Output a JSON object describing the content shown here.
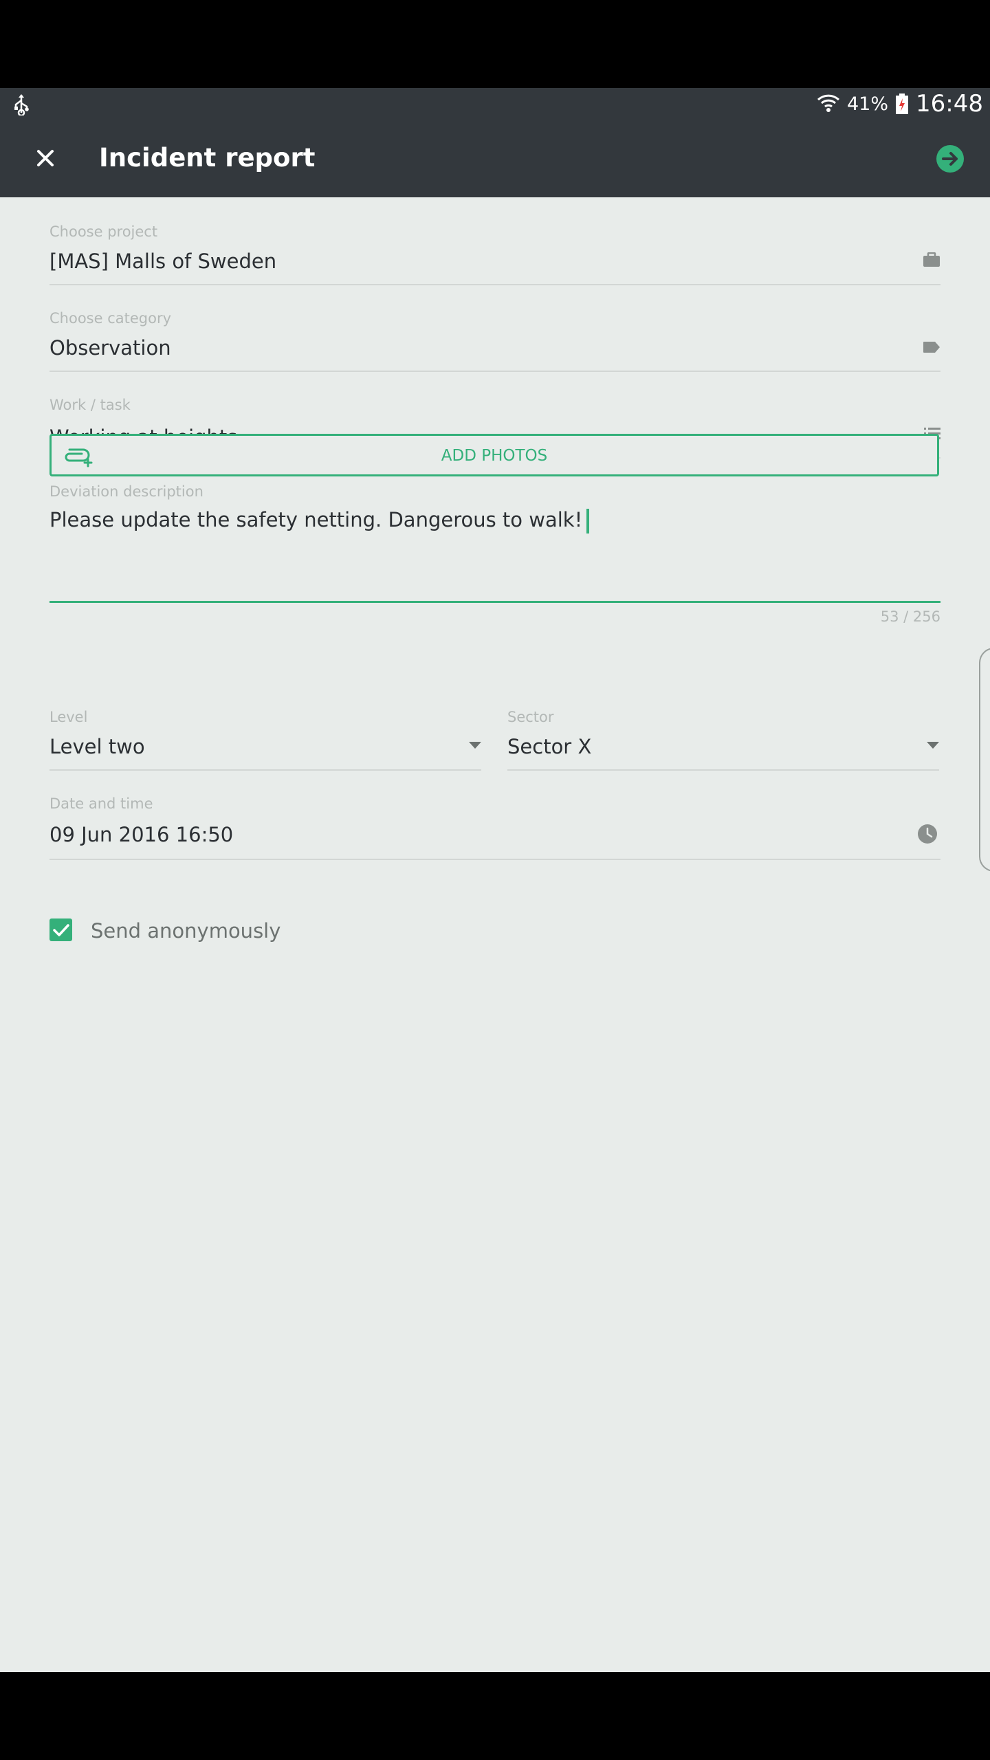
{
  "status_bar": {
    "battery_percent": "41%",
    "time": "16:48",
    "usb_icon": "usb-icon",
    "wifi_icon": "wifi-icon",
    "battery_icon": "battery-icon"
  },
  "app_bar": {
    "title": "Incident report",
    "close_icon": "close-icon",
    "submit_icon": "arrow-right-circle-icon"
  },
  "form": {
    "project": {
      "label": "Choose project",
      "value": "[MAS] Malls of Sweden",
      "icon": "briefcase-icon"
    },
    "category": {
      "label": "Choose category",
      "value": "Observation",
      "icon": "tag-icon"
    },
    "work_task": {
      "label": "Work / task",
      "value": "Working at heights",
      "icon": "list-icon"
    },
    "description": {
      "label": "Deviation description",
      "value": "Please update the safety netting. Dangerous to walk!",
      "counter": "53 / 256"
    },
    "add_photos": {
      "label": "ADD PHOTOS",
      "icon": "attach-add-icon"
    },
    "level": {
      "label": "Level",
      "value": "Level two",
      "icon": "dropdown-arrow-icon"
    },
    "sector": {
      "label": "Sector",
      "value": "Sector X",
      "icon": "dropdown-arrow-icon"
    },
    "date_time": {
      "label": "Date and time",
      "value": "09 Jun 2016 16:50",
      "icon": "clock-icon"
    },
    "send_anonymously": {
      "label": "Send anonymously",
      "checked": true
    }
  },
  "colors": {
    "accent": "#34b07a",
    "app_bar": "#33383d",
    "background": "#e8ecea"
  }
}
